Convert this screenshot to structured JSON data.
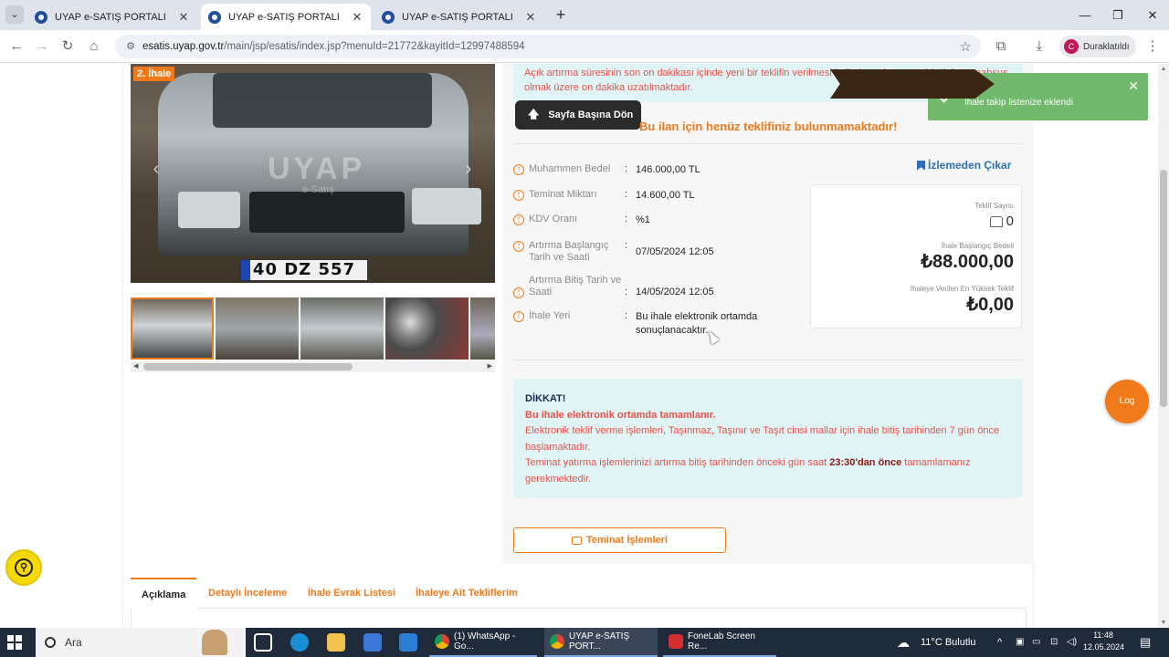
{
  "browser": {
    "tabs": [
      {
        "title": "UYAP e-SATIŞ PORTALI",
        "active": false
      },
      {
        "title": "UYAP e-SATIŞ PORTALI",
        "active": true
      },
      {
        "title": "UYAP e-SATIŞ PORTALI",
        "active": false
      }
    ],
    "url_host": "esatis.uyap.gov.tr",
    "url_path": "/main/jsp/esatis/index.jsp?menuId=21772&kayitId=12997488594",
    "profile_initial": "C",
    "profile_name": "Duraklatıldı"
  },
  "gallery": {
    "badge": "2. İhale",
    "watermark": "UYAP",
    "watermark_sub": "e-Satış",
    "plate_text": "40 DZ 557"
  },
  "notice_top": "Açık artırma süresinin son on dakikası içinde yeni bir teklifin verilmesi halinde açık artırma bir defaya mahsus olmak üzere on dakika uzatılmaktadır.",
  "back_to_top": "Sayfa Başına Dön",
  "no_bid_text": "Bu ilan için henüz teklifiniz bulunmamaktadır!",
  "unwatch_label": "İzlemeden Çıkar",
  "details": [
    {
      "label": "Muhammen Bedel",
      "value": "146.000,00 TL",
      "icon": true
    },
    {
      "label": "Teminat Miktarı",
      "value": "14.600,00 TL",
      "icon": true
    },
    {
      "label": "KDV Oranı",
      "value": "%1",
      "icon": true
    },
    {
      "label": "Artırma Başlangıç Tarih ve Saati",
      "value": "07/05/2024 12:05",
      "icon": true
    },
    {
      "label": "Artırma Bitiş Tarih ve Saati",
      "value": "14/05/2024 12:05",
      "icon": true
    },
    {
      "label": "İhale Yeri",
      "value": "Bu ihale elektronik ortamda sonuçlanacaktır.",
      "icon": true
    }
  ],
  "bid_box": {
    "offer_count_label": "Teklif Sayısı",
    "offer_count": "0",
    "start_price_label": "İhale Başlangıç Bedeli",
    "start_price": "₺88.000,00",
    "highest_bid_label": "İhaleye Verilen En Yüksek Teklif",
    "highest_bid": "₺0,00"
  },
  "dikkat": {
    "title": "DİKKAT!",
    "subtitle": "Bu ihale elektronik ortamda tamamlanır.",
    "line1": "Elektronik teklif verme işlemleri, Taşınmaz, Taşınır ve Taşıt cinsi mallar için ihale bitiş tarihinden 7 gün önce başlamaktadır.",
    "line2_pre": "Teminat yatırma işlemlerinizi artırma bitiş tarihinden önceki gün saat ",
    "line2_bold": "23:30'dan önce",
    "line2_post": " tamamlamanız gerekmektedir."
  },
  "teminat_button": "Teminat İşlemleri",
  "page_tabs": [
    "Açıklama",
    "Detaylı İnceleme",
    "İhale Evrak Listesi",
    "İhaleye Ait Tekliflerim"
  ],
  "log_button": "Log",
  "toast": {
    "message": "İhale takip listenize eklendi"
  },
  "taskbar": {
    "search_placeholder": "Ara",
    "apps": [
      {
        "label": "(1) WhatsApp - Go...",
        "active": false
      },
      {
        "label": "UYAP e-SATIŞ PORT...",
        "active": true
      },
      {
        "label": "FoneLab Screen Re...",
        "active": false
      }
    ],
    "weather": "11°C  Bulutlu",
    "time": "11:48",
    "date": "12.05.2024"
  }
}
